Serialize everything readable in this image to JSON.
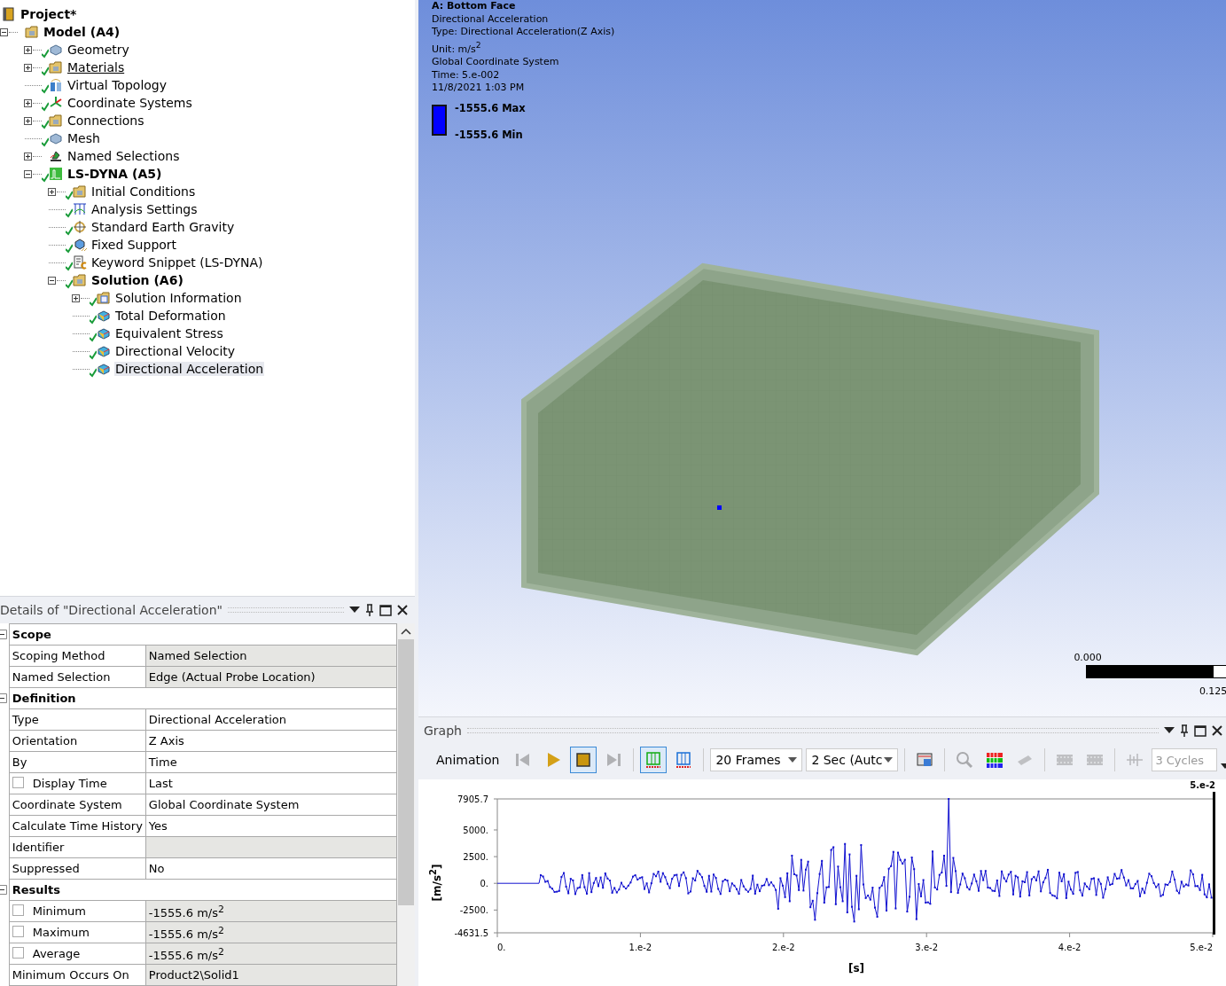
{
  "tree": [
    {
      "label": "Project*",
      "kind": "project",
      "solved": false,
      "bold": true,
      "underlined": false,
      "selected": false
    },
    {
      "label": "Model (A4)",
      "kind": "model",
      "solved": false,
      "bold": true,
      "underlined": false,
      "selected": false,
      "expanded": true,
      "children": [
        {
          "label": "Geometry",
          "kind": "part",
          "solved": true,
          "bold": false,
          "underlined": false,
          "selected": false,
          "expanded": false
        },
        {
          "label": "Materials",
          "kind": "folder",
          "solved": true,
          "bold": false,
          "underlined": true,
          "selected": false,
          "expanded": false
        },
        {
          "label": "Virtual Topology",
          "kind": "topology",
          "solved": true,
          "bold": false,
          "underlined": false,
          "selected": false
        },
        {
          "label": "Coordinate Systems",
          "kind": "axes",
          "solved": true,
          "bold": false,
          "underlined": false,
          "selected": false,
          "expanded": false
        },
        {
          "label": "Connections",
          "kind": "folder",
          "solved": true,
          "bold": false,
          "underlined": false,
          "selected": false,
          "expanded": false
        },
        {
          "label": "Mesh",
          "kind": "part",
          "solved": true,
          "bold": false,
          "underlined": false,
          "selected": false
        },
        {
          "label": "Named Selections",
          "kind": "selection",
          "solved": false,
          "bold": false,
          "underlined": false,
          "selected": false,
          "expanded": false
        },
        {
          "label": "LS-DYNA (A5)",
          "kind": "analysis",
          "solved": true,
          "bold": true,
          "underlined": false,
          "selected": false,
          "expanded": true,
          "children": [
            {
              "label": "Initial Conditions",
              "kind": "folder",
              "solved": true,
              "bold": false,
              "underlined": false,
              "selected": false,
              "expanded": false
            },
            {
              "label": "Analysis Settings",
              "kind": "settings",
              "solved": true,
              "bold": false,
              "underlined": false,
              "selected": false
            },
            {
              "label": "Standard Earth Gravity",
              "kind": "gravity",
              "solved": true,
              "bold": false,
              "underlined": false,
              "selected": false
            },
            {
              "label": "Fixed Support",
              "kind": "support",
              "solved": true,
              "bold": false,
              "underlined": false,
              "selected": false
            },
            {
              "label": "Keyword Snippet (LS-DYNA)",
              "kind": "snippet",
              "solved": true,
              "bold": false,
              "underlined": false,
              "selected": false
            },
            {
              "label": "Solution (A6)",
              "kind": "folder",
              "solved": true,
              "bold": true,
              "underlined": false,
              "selected": false,
              "expanded": true,
              "children": [
                {
                  "label": "Solution Information",
                  "kind": "info",
                  "solved": true,
                  "bold": false,
                  "underlined": false,
                  "selected": false,
                  "expanded": false
                },
                {
                  "label": "Total Deformation",
                  "kind": "result",
                  "solved": true,
                  "bold": false,
                  "underlined": false,
                  "selected": false
                },
                {
                  "label": "Equivalent Stress",
                  "kind": "result",
                  "solved": true,
                  "bold": false,
                  "underlined": false,
                  "selected": false
                },
                {
                  "label": "Directional Velocity",
                  "kind": "result",
                  "solved": true,
                  "bold": false,
                  "underlined": false,
                  "selected": false
                },
                {
                  "label": "Directional Acceleration",
                  "kind": "result",
                  "solved": true,
                  "bold": false,
                  "underlined": false,
                  "selected": true
                }
              ]
            }
          ]
        }
      ]
    }
  ],
  "details": {
    "title": "Details of \"Directional Acceleration\"",
    "groups": [
      {
        "title": "Scope",
        "expanded": true,
        "rows": [
          {
            "kind": "field",
            "label": "Scoping Method",
            "value": "Named Selection",
            "readonly": true
          },
          {
            "kind": "field",
            "label": "Named Selection",
            "value": "Edge (Actual Probe Location)",
            "readonly": true
          }
        ]
      },
      {
        "title": "Definition",
        "expanded": true,
        "rows": [
          {
            "kind": "field",
            "label": "Type",
            "value": "Directional Acceleration",
            "readonly": false
          },
          {
            "kind": "field",
            "label": "Orientation",
            "value": "Z Axis",
            "readonly": false
          },
          {
            "kind": "field",
            "label": "By",
            "value": "Time",
            "readonly": false
          },
          {
            "kind": "checkbox",
            "label": "Display Time",
            "value": "Last",
            "readonly": false,
            "checked": false
          },
          {
            "kind": "field",
            "label": "Coordinate System",
            "value": "Global Coordinate System",
            "readonly": false
          },
          {
            "kind": "field",
            "label": "Calculate Time History",
            "value": "Yes",
            "readonly": false
          },
          {
            "kind": "field",
            "label": "Identifier",
            "value": "",
            "readonly": true
          },
          {
            "kind": "field",
            "label": "Suppressed",
            "value": "No",
            "readonly": false
          }
        ]
      },
      {
        "title": "Results",
        "expanded": true,
        "rows": [
          {
            "kind": "checkbox",
            "label": "Minimum",
            "value": "-1555.6 m/s$^{2}$",
            "readonly": true,
            "checked": false
          },
          {
            "kind": "checkbox",
            "label": "Maximum",
            "value": "-1555.6 m/s$^{2}$",
            "readonly": true,
            "checked": false
          },
          {
            "kind": "checkbox",
            "label": "Average",
            "value": "-1555.6 m/s$^{2}$",
            "readonly": true,
            "checked": false
          },
          {
            "kind": "field",
            "label": "Minimum Occurs On",
            "value": "Product2\\Solid1",
            "readonly": true
          }
        ]
      }
    ]
  },
  "viewport": {
    "title": "A: Bottom Face",
    "info": [
      "Directional Acceleration",
      "Type: Directional Acceleration(Z Axis)",
      "Unit: m/s$^{2}$",
      "Global Coordinate System",
      "Time: 5.e-002",
      "11/8/2021 1:03 PM"
    ],
    "legend": {
      "color": "#0000ff",
      "max": "-1555.6 Max",
      "min": "-1555.6 Min"
    },
    "scale": {
      "start": "0.000",
      "end": "0.125",
      "level": 0.89
    }
  },
  "graph": {
    "title": "Graph",
    "toolbar": {
      "label": "Animation",
      "buttons": [
        {
          "selected": false,
          "disabled": true
        },
        {
          "selected": false,
          "disabled": false
        },
        {
          "selected": true,
          "disabled": false
        },
        {
          "selected": false,
          "disabled": true
        },
        {
          "selected": true,
          "disabled": false
        },
        {
          "selected": false,
          "disabled": false
        }
      ],
      "frames": "20 Frames",
      "duration": "2 Sec (Autc",
      "tools": [
        {
          "disabled": false
        },
        {
          "disabled": true
        },
        {
          "disabled": false
        },
        {
          "disabled": true
        },
        {
          "disabled": true
        },
        {
          "disabled": true
        },
        {
          "disabled": true
        }
      ],
      "cycles": {
        "value": "3 Cycles",
        "disabled": true
      }
    },
    "yticks": [
      "7905.7",
      "5000.",
      "2500.",
      "0.",
      "-2500.",
      "-4631.5"
    ],
    "xticks": [
      "0.",
      "1.e-2",
      "2.e-2",
      "3.e-2",
      "4.e-2",
      "5.e-2"
    ],
    "ylabel": "[m/s$^{2}$]",
    "xlabel": "[s]",
    "cursor": "5.e-2"
  }
}
